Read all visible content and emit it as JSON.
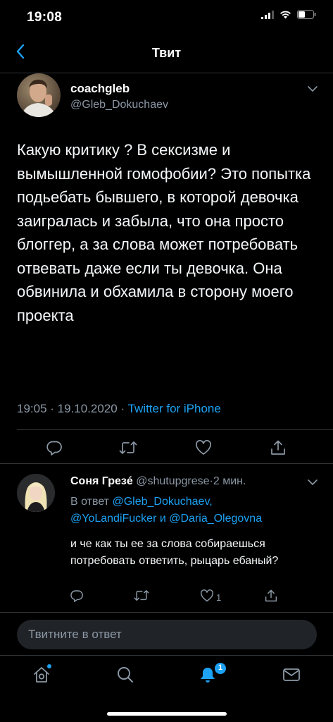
{
  "status_bar": {
    "time": "19:08",
    "icons": [
      "signal-icon",
      "wifi-icon",
      "battery-icon"
    ]
  },
  "nav": {
    "title": "Твит",
    "back_icon": "chevron-left-icon"
  },
  "tweet": {
    "author_name": "coachgleb",
    "author_handle": "@Gleb_Dokuchaev",
    "text": "Какую критику ? В сексизме и вымышленной гомофобии? Это попытка подьебать бывшего, в которой девочка заигралась и забыла, что она просто блоггер, а за слова может потребовать отвевать даже если ты девочка. Она обвинила и обхамила в сторону моего проекта",
    "time": "19:05",
    "separator": " · ",
    "date": "19.10.2020",
    "source": "Twitter for iPhone",
    "actions": [
      "reply-icon",
      "retweet-icon",
      "like-icon",
      "share-icon"
    ]
  },
  "reply": {
    "name": "Соня Грезé",
    "handle": "@shutupgrese",
    "dot": "·",
    "time": "2 мин.",
    "reply_prefix": "В ответ",
    "mention_1": "@Gleb_Dokuchaev,",
    "mention_2": "@YoLandiFucker",
    "conj": "и",
    "mention_3": "@Daria_Olegovna",
    "text": "и че как ты ее за слова собираешься потребовать ответить, рыцарь ебаный?",
    "like_count": "1"
  },
  "compose": {
    "placeholder": "Твитните в ответ"
  },
  "tab_bar": {
    "tabs": [
      "home-icon",
      "search-icon",
      "notifications-icon",
      "messages-icon"
    ],
    "notifications_badge": "1"
  },
  "colors": {
    "background": "#000000",
    "accent": "#1da1f2",
    "secondary_text": "#8b98a5",
    "divider": "#2f3336"
  }
}
